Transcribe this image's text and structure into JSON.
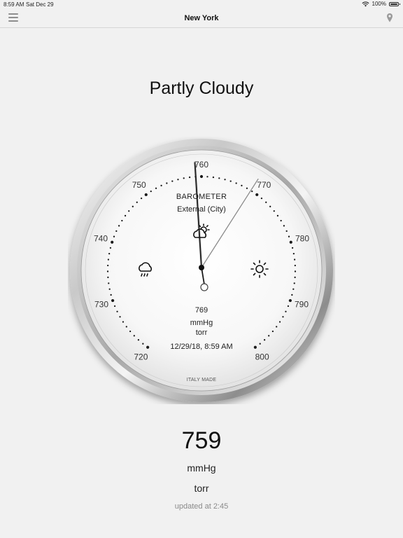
{
  "status_bar": {
    "time": "8:59 AM",
    "date": "Sat Dec 29",
    "battery": "100%"
  },
  "nav": {
    "title": "New York",
    "menu_icon": "hamburger-menu-icon",
    "location_icon": "location-pin-icon"
  },
  "condition": "Partly Cloudy",
  "gauge": {
    "title": "BAROMETER",
    "subtitle": "External (City)",
    "scale_labels": [
      "720",
      "730",
      "740",
      "750",
      "760",
      "770",
      "780",
      "790",
      "800"
    ],
    "scale_min": 720,
    "scale_max": 800,
    "current_value": 759,
    "reference_value": 769,
    "reference_text": "769",
    "unit": "mmHg",
    "unit_alt": "torr",
    "timestamp": "12/29/18, 8:59 AM",
    "maker": "ITALY MADE",
    "icons": [
      "rain-cloud-icon",
      "partly-cloudy-icon",
      "sun-icon"
    ]
  },
  "reading": {
    "value": "759",
    "unit": "mmHg",
    "unit_alt": "torr",
    "updated": "updated at 2:45"
  }
}
